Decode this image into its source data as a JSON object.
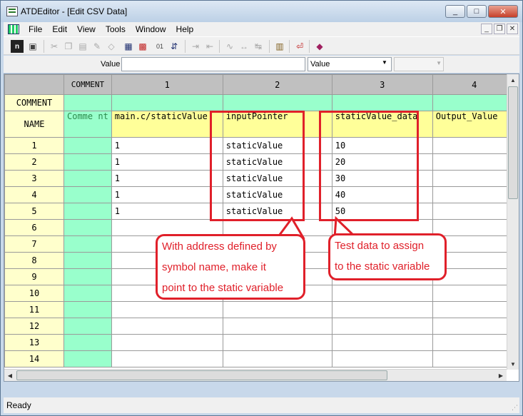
{
  "window": {
    "title": "ATDEditor - [Edit CSV Data]",
    "controls": [
      "_",
      "□",
      "✕"
    ]
  },
  "menu": {
    "items": [
      "File",
      "Edit",
      "View",
      "Tools",
      "Window",
      "Help"
    ],
    "mdi_controls": [
      "_",
      "❐",
      "✕"
    ]
  },
  "valuebar": {
    "label": "Value",
    "input_value": "",
    "select_value": "Value"
  },
  "grid": {
    "column_headers": [
      "COMMENT",
      "1",
      "2",
      "3",
      "4"
    ],
    "comment_row_label": "COMMENT",
    "name_row_label": "NAME",
    "name_cells": [
      "Comme nt",
      "main.c/staticValue",
      "inputPointer",
      "staticValue_data",
      "Output_Value"
    ],
    "rows": [
      {
        "num": "1",
        "c1": "1",
        "c2": "staticValue",
        "c3": "10",
        "c4": ""
      },
      {
        "num": "2",
        "c1": "1",
        "c2": "staticValue",
        "c3": "20",
        "c4": ""
      },
      {
        "num": "3",
        "c1": "1",
        "c2": "staticValue",
        "c3": "30",
        "c4": ""
      },
      {
        "num": "4",
        "c1": "1",
        "c2": "staticValue",
        "c3": "40",
        "c4": ""
      },
      {
        "num": "5",
        "c1": "1",
        "c2": "staticValue",
        "c3": "50",
        "c4": ""
      },
      {
        "num": "6",
        "c1": "",
        "c2": "",
        "c3": "",
        "c4": ""
      },
      {
        "num": "7",
        "c1": "",
        "c2": "",
        "c3": "",
        "c4": ""
      },
      {
        "num": "8",
        "c1": "",
        "c2": "",
        "c3": "",
        "c4": ""
      },
      {
        "num": "9",
        "c1": "",
        "c2": "",
        "c3": "",
        "c4": ""
      },
      {
        "num": "10",
        "c1": "",
        "c2": "",
        "c3": "",
        "c4": ""
      },
      {
        "num": "11",
        "c1": "",
        "c2": "",
        "c3": "",
        "c4": ""
      },
      {
        "num": "12",
        "c1": "",
        "c2": "",
        "c3": "",
        "c4": ""
      },
      {
        "num": "13",
        "c1": "",
        "c2": "",
        "c3": "",
        "c4": ""
      },
      {
        "num": "14",
        "c1": "",
        "c2": "",
        "c3": "",
        "c4": ""
      }
    ]
  },
  "annotations": {
    "callout_left": [
      "With address defined by",
      "symbol name, make it",
      "point to the static variable"
    ],
    "callout_right": [
      "Test data to assign",
      "to the static variable"
    ]
  },
  "status": {
    "text": "Ready"
  },
  "colors": {
    "highlight": "#e0202a",
    "name_row": "#ffff99",
    "comment_col": "#99ffcc",
    "row_header": "#ffffcc"
  }
}
